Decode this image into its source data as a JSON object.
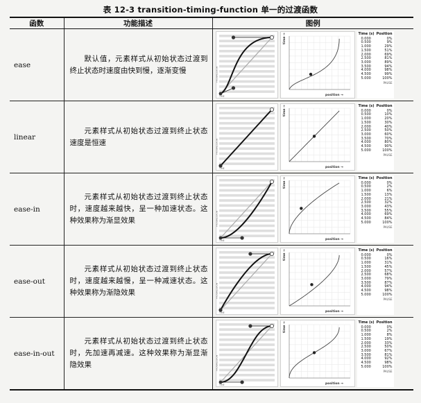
{
  "caption": "表 12-3   transition-timing-function 单一的过渡函数",
  "headers": {
    "func": "函数",
    "desc": "功能描述",
    "example": "图例"
  },
  "table_headers": {
    "time": "Time (s)",
    "position": "Position"
  },
  "graph_labels": {
    "time": "time →",
    "position": "position →",
    "pause": "PAUSE",
    "progression": "PROGRESSION",
    "time_small": "TIME"
  },
  "rows": [
    {
      "name": "ease",
      "desc": "默认值，元素样式从初始状态过渡到终止状态时速度由快到慢，逐渐变慢",
      "marker": {
        "time": 1.5,
        "position": 0.43
      },
      "table": [
        [
          "0.000",
          "0%"
        ],
        [
          "0.500",
          "9%"
        ],
        [
          "1.000",
          "29%"
        ],
        [
          "1.500",
          "51%"
        ],
        [
          "2.000",
          "69%"
        ],
        [
          "2.500",
          "81%"
        ],
        [
          "3.000",
          "89%"
        ],
        [
          "3.500",
          "94%"
        ],
        [
          "4.000",
          "98%"
        ],
        [
          "4.500",
          "99%"
        ],
        [
          "5.000",
          "100%"
        ]
      ]
    },
    {
      "name": "linear",
      "desc": "元素样式从初始状态过渡到终止状态速度是恒速",
      "marker": {
        "time": 2.5,
        "position": 0.5
      },
      "table": [
        [
          "0.000",
          "0%"
        ],
        [
          "0.500",
          "10%"
        ],
        [
          "1.000",
          "20%"
        ],
        [
          "1.500",
          "30%"
        ],
        [
          "2.000",
          "40%"
        ],
        [
          "2.500",
          "50%"
        ],
        [
          "3.000",
          "60%"
        ],
        [
          "3.500",
          "70%"
        ],
        [
          "4.000",
          "80%"
        ],
        [
          "4.500",
          "90%"
        ],
        [
          "5.000",
          "100%"
        ]
      ]
    },
    {
      "name": "ease-in",
      "desc": "元素样式从初始状态过渡到终止状态时，速度越来越快，呈一种加速状态。这种效果称为渐显效果",
      "marker": {
        "time": 2.5,
        "position": 0.24
      },
      "table": [
        [
          "0.000",
          "0%"
        ],
        [
          "0.500",
          "2%"
        ],
        [
          "1.000",
          "6%"
        ],
        [
          "1.500",
          "13%"
        ],
        [
          "2.000",
          "21%"
        ],
        [
          "2.500",
          "32%"
        ],
        [
          "3.000",
          "43%"
        ],
        [
          "3.500",
          "55%"
        ],
        [
          "4.000",
          "69%"
        ],
        [
          "4.500",
          "84%"
        ],
        [
          "5.000",
          "100%"
        ]
      ]
    },
    {
      "name": "ease-out",
      "desc": "元素样式从初始状态过渡到终止状态时，速度越来越慢，呈一种减速状态。这种效果称为渐隐效果",
      "marker": {
        "time": 2.1,
        "position": 0.45
      },
      "table": [
        [
          "0.000",
          "0%"
        ],
        [
          "0.500",
          "16%"
        ],
        [
          "1.000",
          "31%"
        ],
        [
          "1.500",
          "45%"
        ],
        [
          "2.000",
          "57%"
        ],
        [
          "2.500",
          "68%"
        ],
        [
          "3.000",
          "79%"
        ],
        [
          "3.500",
          "87%"
        ],
        [
          "4.000",
          "94%"
        ],
        [
          "4.500",
          "98%"
        ],
        [
          "5.000",
          "100%"
        ]
      ]
    },
    {
      "name": "ease-in-out",
      "desc": "元素样式从初始状态过渡到终止状态时，先加速再减速。这种效果称为渐显渐隐效果",
      "marker": {
        "time": 2.5,
        "position": 0.5
      },
      "table": [
        [
          "0.000",
          "0%"
        ],
        [
          "0.500",
          "2%"
        ],
        [
          "1.000",
          "8%"
        ],
        [
          "1.500",
          "19%"
        ],
        [
          "2.000",
          "33%"
        ],
        [
          "2.500",
          "50%"
        ],
        [
          "3.000",
          "67%"
        ],
        [
          "3.500",
          "81%"
        ],
        [
          "4.000",
          "92%"
        ],
        [
          "4.500",
          "98%"
        ],
        [
          "5.000",
          "100%"
        ]
      ]
    }
  ]
}
